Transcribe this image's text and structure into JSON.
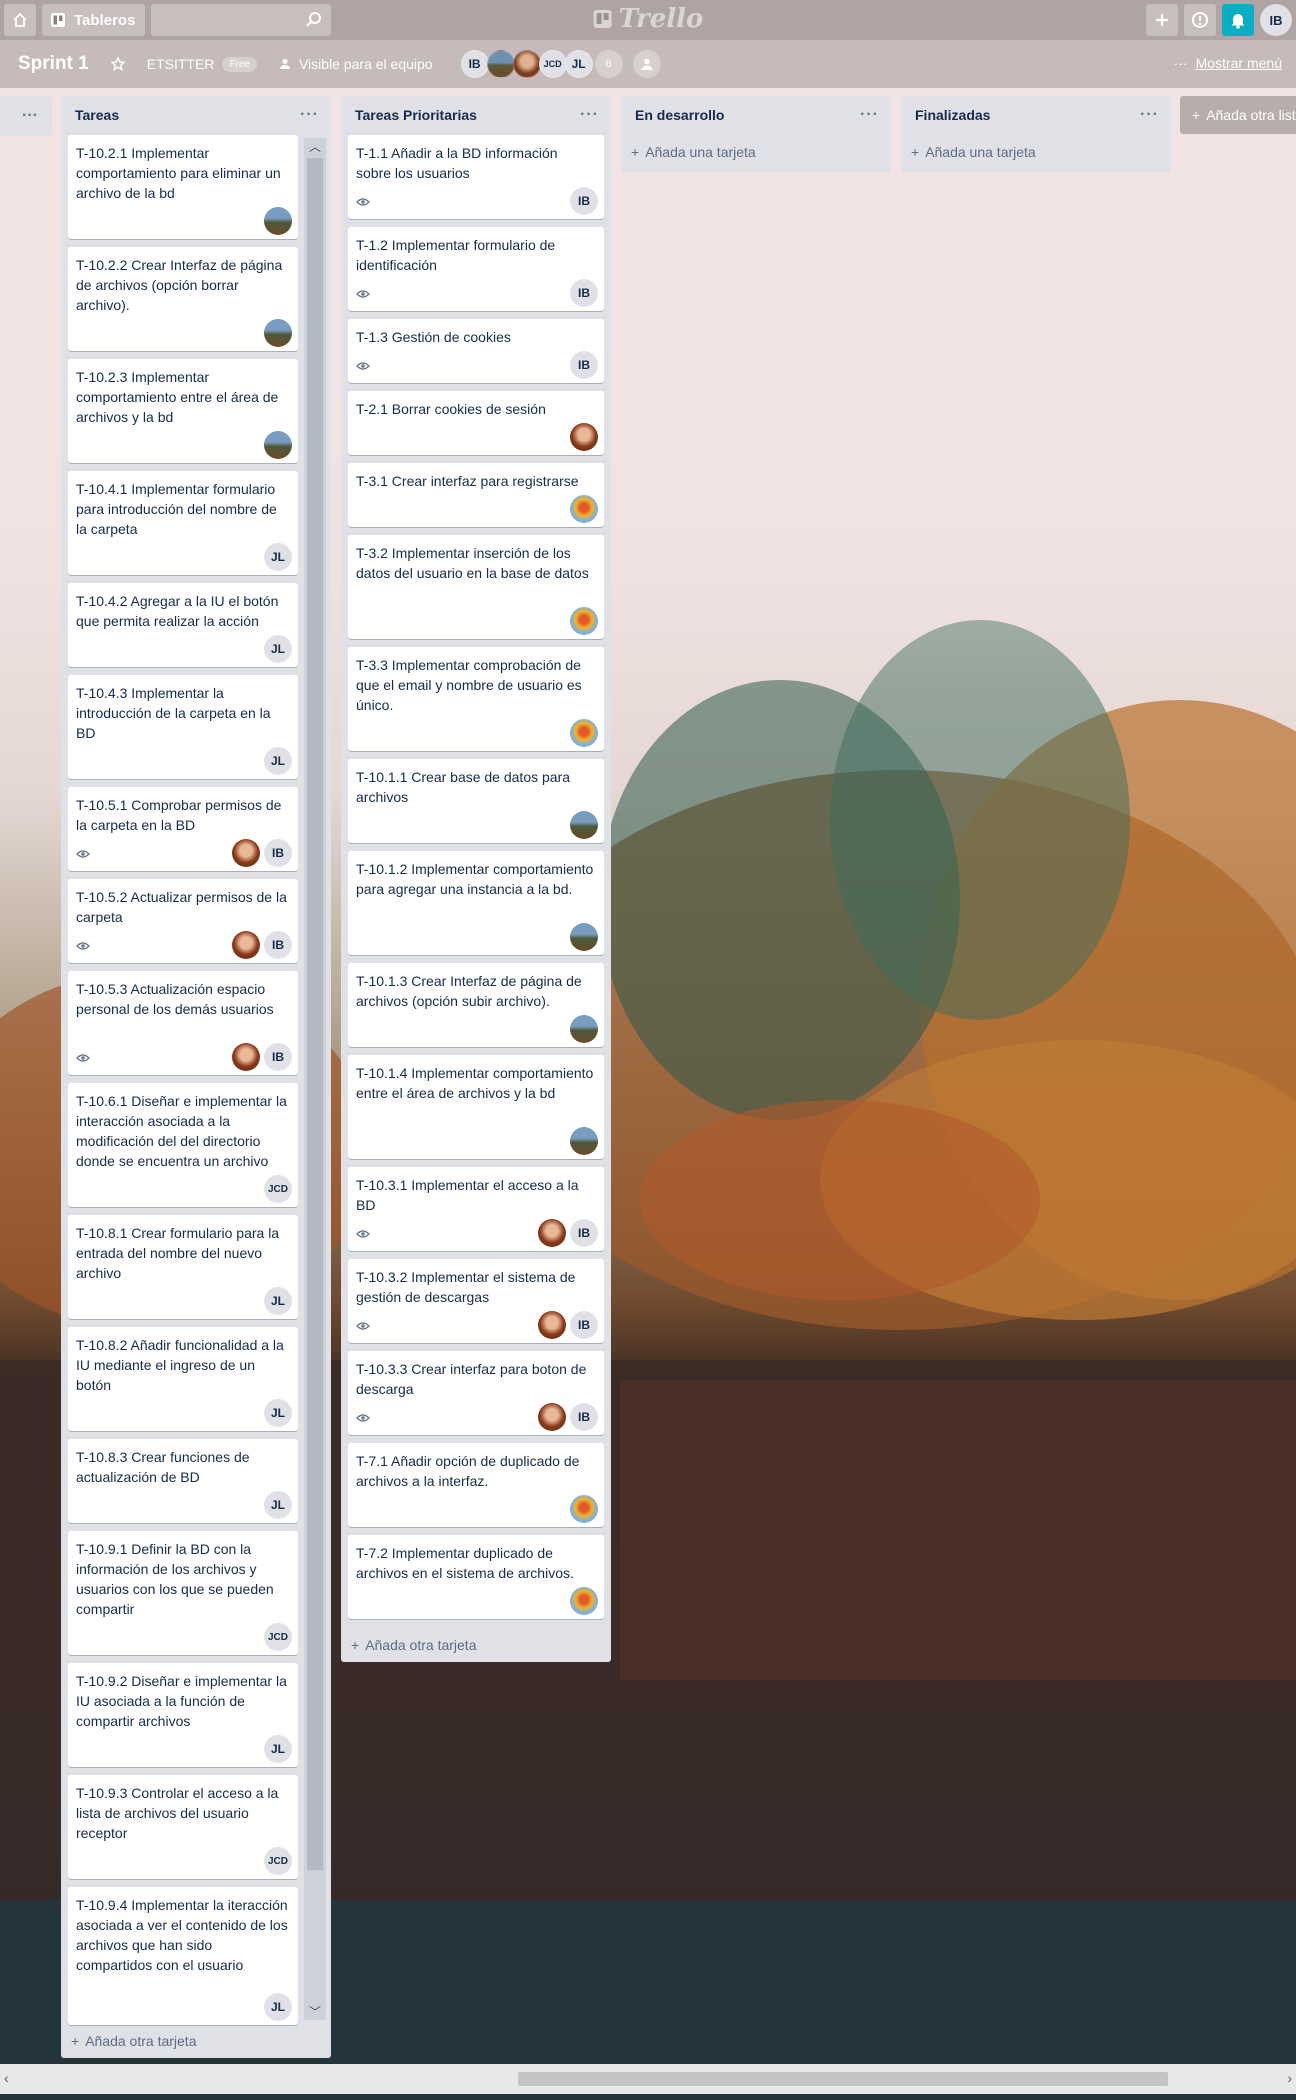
{
  "header": {
    "boards_label": "Tableros",
    "search_placeholder": "",
    "logo_text": "Trello",
    "user_initials": "IB"
  },
  "board": {
    "title": "Sprint 1",
    "team": "ETSITTER",
    "plan_badge": "Free",
    "visibility": "Visible para el equipo",
    "members": [
      "IB",
      "",
      "",
      "JCD",
      "JL"
    ],
    "member_count": "6",
    "show_menu": "Mostrar menú"
  },
  "lists": [
    {
      "title": "Tareas",
      "add_label": "Añada otra tarjeta",
      "cards": [
        {
          "text": "T-10.2.1 Implementar comportamiento para eliminar un archivo de la bd",
          "eye": false,
          "avatars": [
            "landscape"
          ]
        },
        {
          "text": "T-10.2.2 Crear Interfaz de página de archivos (opción borrar archivo).",
          "eye": false,
          "avatars": [
            "landscape"
          ]
        },
        {
          "text": "T-10.2.3 Implementar comportamiento entre el área de archivos y la bd",
          "eye": false,
          "avatars": [
            "landscape"
          ]
        },
        {
          "text": "T-10.4.1 Implementar formulario para introducción del nombre de la carpeta",
          "eye": false,
          "avatars": [
            "JL"
          ]
        },
        {
          "text": "T-10.4.2 Agregar a la IU el botón que permita realizar la acción",
          "eye": false,
          "avatars": [
            "JL"
          ]
        },
        {
          "text": "T-10.4.3 Implementar la introducción de la carpeta en la BD",
          "eye": false,
          "avatars": [
            "JL"
          ]
        },
        {
          "text": "T-10.5.1 Comprobar permisos de la carpeta en la BD",
          "eye": true,
          "avatars": [
            "woman",
            "IB"
          ]
        },
        {
          "text": "T-10.5.2 Actualizar permisos de la carpeta",
          "eye": true,
          "avatars": [
            "woman",
            "IB"
          ]
        },
        {
          "text": "T-10.5.3 Actualización espacio personal de los demás usuarios",
          "eye": true,
          "avatars": [
            "woman",
            "IB"
          ]
        },
        {
          "text": "T-10.6.1 Diseñar e implementar la interacción asociada a la modificación del del directorio donde se encuentra un archivo",
          "eye": false,
          "avatars": [
            "JCD"
          ]
        },
        {
          "text": "T-10.8.1 Crear formulario para la entrada del nombre del nuevo archivo",
          "eye": false,
          "avatars": [
            "JL"
          ]
        },
        {
          "text": "T-10.8.2 Añadir funcionalidad a la IU mediante el ingreso de un botón",
          "eye": false,
          "avatars": [
            "JL"
          ]
        },
        {
          "text": "T-10.8.3 Crear funciones de actualización de BD",
          "eye": false,
          "avatars": [
            "JL"
          ]
        },
        {
          "text": "T-10.9.1 Definir la BD con la información de los archivos y usuarios con los que se pueden compartir",
          "eye": false,
          "avatars": [
            "JCD"
          ]
        },
        {
          "text": "T-10.9.2 Diseñar e implementar la IU asociada a la función de compartir archivos",
          "eye": false,
          "avatars": [
            "JL"
          ]
        },
        {
          "text": "T-10.9.3 Controlar el acceso a la lista de archivos del usuario receptor",
          "eye": false,
          "avatars": [
            "JCD"
          ]
        },
        {
          "text": "T-10.9.4 Implementar la iteracción asociada a ver el contenido de los archivos que han sido compartidos con el usuario",
          "eye": false,
          "avatars": [
            "JL"
          ]
        }
      ]
    },
    {
      "title": "Tareas Prioritarias",
      "add_label": "Añada otra tarjeta",
      "cards": [
        {
          "text": "T-1.1 Añadir a la BD información sobre los usuarios",
          "eye": true,
          "avatars": [
            "IB"
          ]
        },
        {
          "text": "T-1.2 Implementar formulario de identificación",
          "eye": true,
          "avatars": [
            "IB"
          ]
        },
        {
          "text": "T-1.3 Gestión de cookies",
          "eye": true,
          "avatars": [
            "IB"
          ]
        },
        {
          "text": "T-2.1 Borrar cookies de sesión",
          "eye": false,
          "avatars": [
            "woman"
          ]
        },
        {
          "text": "T-3.1 Crear interfaz para registrarse",
          "eye": false,
          "avatars": [
            "balloon"
          ]
        },
        {
          "text": "T-3.2 Implementar inserción de los datos del usuario en la base de datos",
          "eye": false,
          "avatars": [
            "balloon"
          ]
        },
        {
          "text": "T-3.3 Implementar comprobación de que el email y nombre de usuario es único.",
          "eye": false,
          "avatars": [
            "balloon"
          ]
        },
        {
          "text": "T-10.1.1 Crear base de datos para archivos",
          "eye": false,
          "avatars": [
            "landscape"
          ]
        },
        {
          "text": "T-10.1.2 Implementar comportamiento para agregar una instancia a la bd.",
          "eye": false,
          "avatars": [
            "landscape"
          ]
        },
        {
          "text": "T-10.1.3 Crear Interfaz de página de archivos (opción subir archivo).",
          "eye": false,
          "avatars": [
            "landscape"
          ]
        },
        {
          "text": "T-10.1.4 Implementar comportamiento entre el área de archivos y la bd",
          "eye": false,
          "avatars": [
            "landscape"
          ]
        },
        {
          "text": "T-10.3.1 Implementar el acceso a la BD",
          "eye": true,
          "avatars": [
            "woman",
            "IB"
          ]
        },
        {
          "text": "T-10.3.2 Implementar el sistema de gestión de descargas",
          "eye": true,
          "avatars": [
            "woman",
            "IB"
          ]
        },
        {
          "text": "T-10.3.3 Crear interfaz para boton de descarga",
          "eye": true,
          "avatars": [
            "woman",
            "IB"
          ]
        },
        {
          "text": "T-7.1 Añadir opción de duplicado de archivos a la interfaz.",
          "eye": false,
          "avatars": [
            "balloon"
          ]
        },
        {
          "text": "T-7.2 Implementar duplicado de archivos en el sistema de archivos.",
          "eye": false,
          "avatars": [
            "balloon"
          ]
        }
      ]
    },
    {
      "title": "En desarrollo",
      "add_label": "Añada una tarjeta",
      "cards": []
    },
    {
      "title": "Finalizadas",
      "add_label": "Añada una tarjeta",
      "cards": []
    }
  ],
  "add_list_label": "Añada otra lista",
  "list_menu_glyph": "···"
}
